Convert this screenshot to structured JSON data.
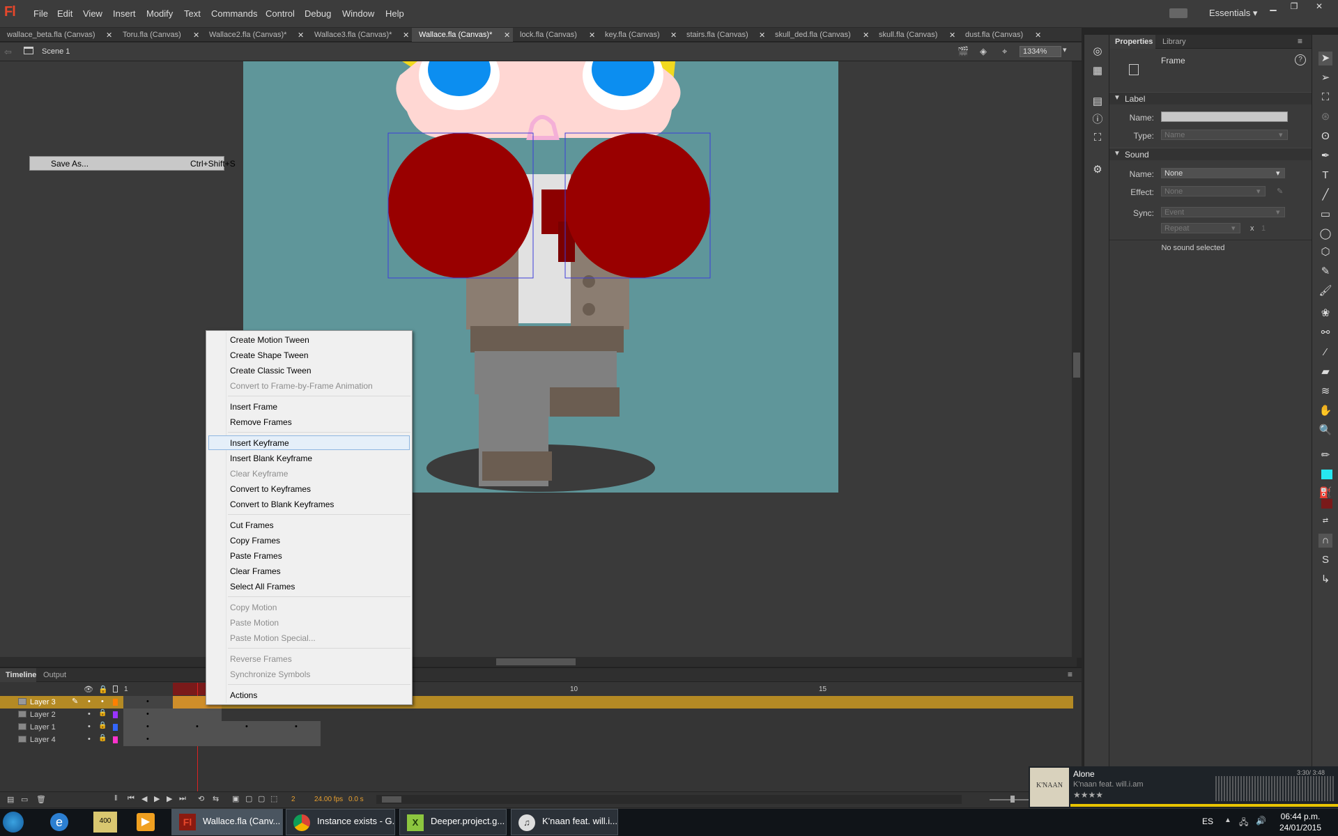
{
  "app": {
    "logo": "Fl",
    "workspace": "Essentials"
  },
  "menu": [
    "File",
    "Edit",
    "View",
    "Insert",
    "Modify",
    "Text",
    "Commands",
    "Control",
    "Debug",
    "Window",
    "Help"
  ],
  "tabs": [
    {
      "label": "wallace_beta.fla (Canvas)",
      "active": false
    },
    {
      "label": "Toru.fla (Canvas)",
      "active": false
    },
    {
      "label": "Wallace2.fla (Canvas)*",
      "active": false
    },
    {
      "label": "Wallace3.fla (Canvas)*",
      "active": false
    },
    {
      "label": "Wallace.fla (Canvas)*",
      "active": true
    },
    {
      "label": "lock.fla (Canvas)",
      "active": false
    },
    {
      "label": "key.fla (Canvas)",
      "active": false
    },
    {
      "label": "stairs.fla (Canvas)",
      "active": false
    },
    {
      "label": "skull_ded.fla (Canvas)",
      "active": false
    },
    {
      "label": "skull.fla (Canvas)",
      "active": false
    },
    {
      "label": "dust.fla (Canvas)",
      "active": false
    }
  ],
  "scene": {
    "label": "Scene 1",
    "zoom": "1334%"
  },
  "save_as": {
    "label": "Save As...",
    "shortcut": "Ctrl+Shift+S"
  },
  "context_menu": {
    "groups": [
      [
        {
          "label": "Create Motion Tween",
          "enabled": true
        },
        {
          "label": "Create Shape Tween",
          "enabled": true
        },
        {
          "label": "Create Classic Tween",
          "enabled": true
        },
        {
          "label": "Convert to Frame-by-Frame Animation",
          "enabled": false
        }
      ],
      [
        {
          "label": "Insert Frame",
          "enabled": true
        },
        {
          "label": "Remove Frames",
          "enabled": true
        }
      ],
      [
        {
          "label": "Insert Keyframe",
          "enabled": true,
          "highlighted": true
        },
        {
          "label": "Insert Blank Keyframe",
          "enabled": true
        },
        {
          "label": "Clear Keyframe",
          "enabled": false
        },
        {
          "label": "Convert to Keyframes",
          "enabled": true
        },
        {
          "label": "Convert to Blank Keyframes",
          "enabled": true
        }
      ],
      [
        {
          "label": "Cut Frames",
          "enabled": true
        },
        {
          "label": "Copy Frames",
          "enabled": true
        },
        {
          "label": "Paste Frames",
          "enabled": true
        },
        {
          "label": "Clear Frames",
          "enabled": true
        },
        {
          "label": "Select All Frames",
          "enabled": true
        }
      ],
      [
        {
          "label": "Copy Motion",
          "enabled": false
        },
        {
          "label": "Paste Motion",
          "enabled": false
        },
        {
          "label": "Paste Motion Special...",
          "enabled": false
        }
      ],
      [
        {
          "label": "Reverse Frames",
          "enabled": false
        },
        {
          "label": "Synchronize Symbols",
          "enabled": false
        }
      ],
      [
        {
          "label": "Actions",
          "enabled": true
        }
      ]
    ]
  },
  "timeline": {
    "tabs": [
      "Timeline",
      "Output"
    ],
    "ruler": [
      "1",
      "10",
      "15"
    ],
    "layers": [
      {
        "name": "Layer 3",
        "color": "#ff7f00",
        "selected": true
      },
      {
        "name": "Layer 2",
        "color": "#9933ff",
        "selected": false
      },
      {
        "name": "Layer 1",
        "color": "#3366ff",
        "selected": false
      },
      {
        "name": "Layer 4",
        "color": "#ff33cc",
        "selected": false
      }
    ],
    "status": {
      "frame": "2",
      "fps": "24.00 fps",
      "time": "0.0 s"
    }
  },
  "properties": {
    "tabs": [
      "Properties",
      "Library"
    ],
    "type": "Frame",
    "label_section": {
      "title": "Label",
      "name_label": "Name:",
      "type_label": "Type:",
      "type_value": "Name"
    },
    "sound_section": {
      "title": "Sound",
      "name_label": "Name:",
      "name_value": "None",
      "effect_label": "Effect:",
      "effect_value": "None",
      "sync_label": "Sync:",
      "sync_value": "Event",
      "repeat_value": "Repeat",
      "x_label": "x",
      "repeat_count": "1",
      "status": "No sound selected"
    }
  },
  "player": {
    "song": "Alone",
    "artist": "K'naan feat. will.i.am",
    "time": "3:30/ 3:48",
    "album_text": "K'NAAN",
    "rating": "★★★★"
  },
  "taskbar": {
    "buttons": [
      "Wallace.fla (Canv...",
      "Instance exists - G...",
      "Deeper.project.g...",
      "K'naan feat. will.i...."
    ],
    "lang": "ES",
    "time": "06:44 p.m.",
    "date": "24/01/2015",
    "tray_text": "400"
  }
}
